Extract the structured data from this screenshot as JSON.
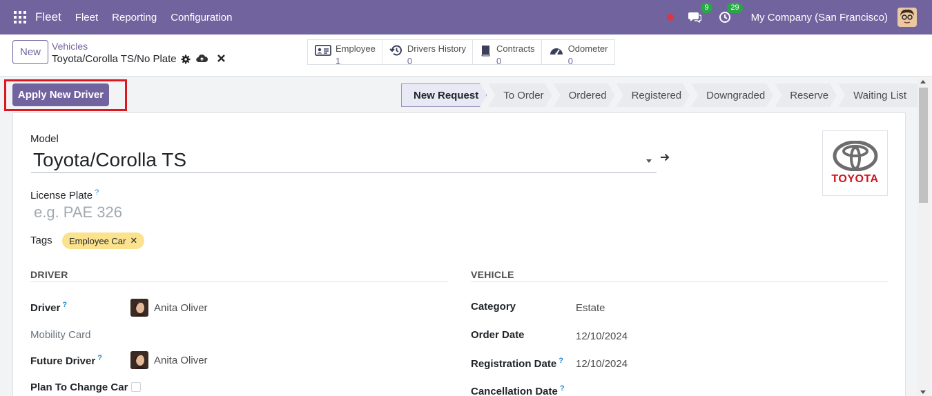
{
  "navbar": {
    "app_name": "Fleet",
    "menu": [
      "Fleet",
      "Reporting",
      "Configuration"
    ],
    "messages_count": "9",
    "activities_count": "29",
    "company": "My Company (San Francisco)",
    "bg_color": "#71639e"
  },
  "control": {
    "new_label": "New",
    "breadcrumb_parent": "Vehicles",
    "breadcrumb_current": "Toyota/Corolla TS/No Plate",
    "smart_buttons": [
      {
        "label": "Employee",
        "count": "1",
        "icon": "id-card-icon"
      },
      {
        "label": "Drivers History",
        "count": "0",
        "icon": "history-icon"
      },
      {
        "label": "Contracts",
        "count": "0",
        "icon": "book-icon"
      },
      {
        "label": "Odometer",
        "count": "0",
        "icon": "tachometer-icon"
      }
    ]
  },
  "actions": {
    "apply_new_driver": "Apply New Driver"
  },
  "status_stages": [
    "New Request",
    "To Order",
    "Ordered",
    "Registered",
    "Downgraded",
    "Reserve",
    "Waiting List"
  ],
  "status_active": "New Request",
  "form": {
    "model_label": "Model",
    "model_value": "Toyota/Corolla TS",
    "license_plate_label": "License Plate",
    "license_plate_placeholder": "e.g. PAE 326",
    "help_mark": "?",
    "tags_label": "Tags",
    "tags": [
      "Employee Car"
    ],
    "logo_text": "TOYOTA",
    "driver_section": "DRIVER",
    "vehicle_section": "VEHICLE",
    "driver_label": "Driver",
    "driver_value": "Anita Oliver",
    "mobility_card_label": "Mobility Card",
    "future_driver_label": "Future Driver",
    "future_driver_value": "Anita Oliver",
    "plan_change_label": "Plan To Change Car",
    "category_label": "Category",
    "category_value": "Estate",
    "order_date_label": "Order Date",
    "order_date_value": "12/10/2024",
    "registration_date_label": "Registration Date",
    "registration_date_value": "12/10/2024",
    "cancellation_date_label": "Cancellation Date"
  }
}
